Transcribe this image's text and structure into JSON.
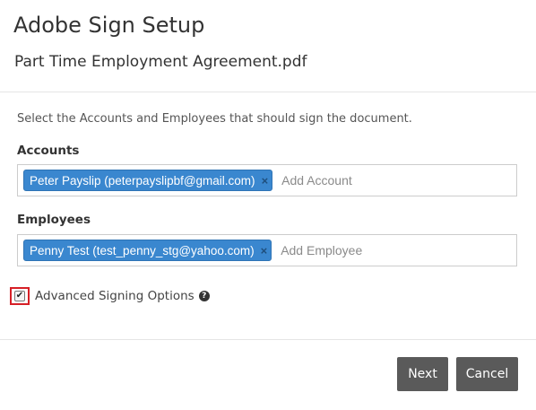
{
  "header": {
    "title": "Adobe Sign Setup",
    "document_name": "Part Time Employment Agreement.pdf"
  },
  "form": {
    "instructions": "Select the Accounts and Employees that should sign the document.",
    "accounts": {
      "label": "Accounts",
      "selected": [
        {
          "label": "Peter Payslip (peterpayslipbf@gmail.com)",
          "remove": "×"
        }
      ],
      "placeholder": "Add Account"
    },
    "employees": {
      "label": "Employees",
      "selected": [
        {
          "label": "Penny Test (test_penny_stg@yahoo.com)",
          "remove": "×"
        }
      ],
      "placeholder": "Add Employee"
    },
    "advanced": {
      "label": "Advanced Signing Options",
      "checked": true,
      "check_glyph": "✔",
      "help_glyph": "?"
    }
  },
  "footer": {
    "next_label": "Next",
    "cancel_label": "Cancel"
  },
  "colors": {
    "tag_background": "#3a87cf",
    "button_background": "#5a5a5a",
    "highlight_border": "#d61f26"
  },
  "icons": {
    "remove": "close-icon",
    "help": "question-circle-icon",
    "check": "checkmark-icon"
  }
}
